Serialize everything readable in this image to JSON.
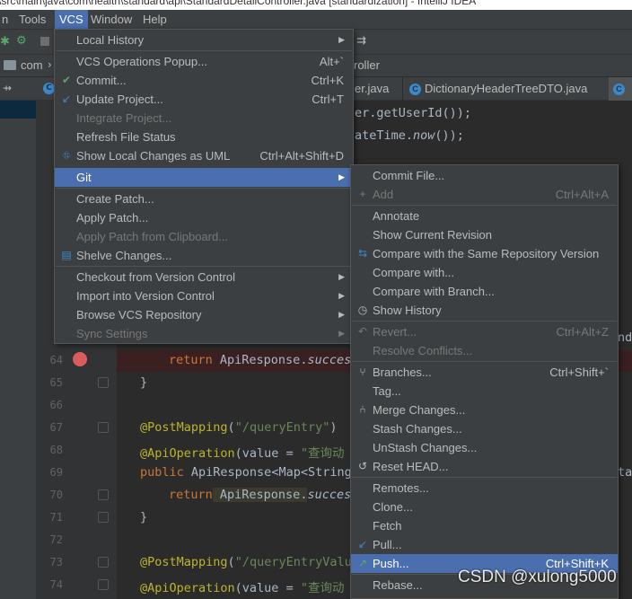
{
  "window": {
    "title": "\\src\\main\\java\\com\\health\\standard\\api\\StandardDetailController.java [standardization] - IntelliJ IDEA"
  },
  "menubar": [
    "n",
    "Tools",
    "VCS",
    "Window",
    "Help"
  ],
  "nav": {
    "crumb": "com",
    "right": "roller"
  },
  "tabs": [
    {
      "label": "er.java"
    },
    {
      "label": "DictionaryHeaderTreeDTO.java"
    }
  ],
  "vcs_menu": [
    {
      "label": "Local History",
      "submenu": true
    },
    {
      "label": "VCS Operations Popup...",
      "shortcut": "Alt+`"
    },
    {
      "label": "Commit...",
      "shortcut": "Ctrl+K",
      "icon": "check-icon"
    },
    {
      "label": "Update Project...",
      "shortcut": "Ctrl+T",
      "icon": "update-arrow-icon"
    },
    {
      "label": "Integrate Project...",
      "disabled": true
    },
    {
      "label": "Refresh File Status"
    },
    {
      "label": "Show Local Changes as UML",
      "shortcut": "Ctrl+Alt+Shift+D",
      "icon": "uml-icon"
    },
    {
      "label": "Git",
      "submenu": true,
      "selected": true
    },
    {
      "label": "Create Patch..."
    },
    {
      "label": "Apply Patch..."
    },
    {
      "label": "Apply Patch from Clipboard...",
      "disabled": true
    },
    {
      "label": "Shelve Changes...",
      "icon": "shelve-icon"
    },
    {
      "label": "Checkout from Version Control",
      "submenu": true
    },
    {
      "label": "Import into Version Control",
      "submenu": true
    },
    {
      "label": "Browse VCS Repository",
      "submenu": true
    },
    {
      "label": "Sync Settings",
      "submenu": true,
      "disabled": true
    }
  ],
  "git_menu": [
    {
      "label": "Commit File..."
    },
    {
      "label": "Add",
      "shortcut": "Ctrl+Alt+A",
      "disabled": true,
      "icon": "plus-icon"
    },
    {
      "label": "Annotate"
    },
    {
      "label": "Show Current Revision"
    },
    {
      "label": "Compare with the Same Repository Version",
      "icon": "compare-icon"
    },
    {
      "label": "Compare with..."
    },
    {
      "label": "Compare with Branch..."
    },
    {
      "label": "Show History",
      "icon": "clock-icon"
    },
    {
      "label": "Revert...",
      "shortcut": "Ctrl+Alt+Z",
      "disabled": true,
      "icon": "revert-icon"
    },
    {
      "label": "Resolve Conflicts...",
      "disabled": true
    },
    {
      "label": "Branches...",
      "shortcut": "Ctrl+Shift+`",
      "icon": "branch-icon"
    },
    {
      "label": "Tag..."
    },
    {
      "label": "Merge Changes...",
      "icon": "merge-icon"
    },
    {
      "label": "Stash Changes..."
    },
    {
      "label": "UnStash Changes..."
    },
    {
      "label": "Reset HEAD...",
      "icon": "reset-icon"
    },
    {
      "label": "Remotes..."
    },
    {
      "label": "Clone..."
    },
    {
      "label": "Fetch"
    },
    {
      "label": "Pull...",
      "icon": "pull-arrow-icon"
    },
    {
      "label": "Push...",
      "shortcut": "Ctrl+Shift+K",
      "selected": true,
      "icon": "push-arrow-icon"
    },
    {
      "label": "Rebase..."
    }
  ],
  "editor": {
    "line_numbers": [
      "5",
      "5",
      "5",
      "5",
      "5",
      "5",
      "5",
      "5",
      "6",
      "6",
      "6",
      "6",
      "6",
      "64",
      "65",
      "66",
      "67",
      "68",
      "69",
      "70",
      "71",
      "72",
      "73",
      "74"
    ],
    "code_right": {
      "l1": "er.getUserId());",
      "l2_a": "ateTime.",
      "l2_b": "now",
      "l2_c": "());"
    },
    "line64": {
      "kw": "return",
      "text": " ApiResponse.",
      "it": "succes"
    },
    "line65": "}",
    "line67": {
      "ann": "@PostMapping",
      "paren": "(",
      "str": "\"/queryEntry\"",
      "close": ")"
    },
    "line68": {
      "ann": "@ApiOperation",
      "a": "(value = ",
      "str": "\"查询动"
    },
    "line69": {
      "kw": "public",
      "text": " ApiResponse<Map<String"
    },
    "line70": {
      "kw": "return",
      "text": " ApiResponse.",
      "it": "succes"
    },
    "line71": "}",
    "line73": {
      "ann": "@PostMapping",
      "paren": "(",
      "str": "\"/queryEntryValu"
    },
    "line74": {
      "ann": "@ApiOperation",
      "a": "(value = ",
      "str": "\"查询动"
    },
    "cut_right": {
      "l1": "nda",
      "l2": "tar"
    }
  },
  "watermark": "CSDN @xulong5000"
}
